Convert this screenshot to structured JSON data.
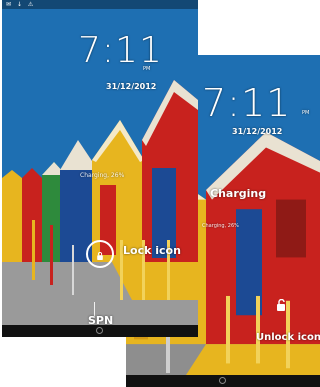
{
  "front_screen": {
    "clock_time": "7:11",
    "am_pm": "PM",
    "date": "31/12/2012",
    "charging_status": "Charging, 26%",
    "lock_label": "Lock icon",
    "carrier_label": "SPN",
    "status_icons": "✉ ↓ ⚠"
  },
  "back_screen": {
    "clock_time": "7:11",
    "am_pm": "PM",
    "date": "31/12/2012",
    "charging_label": "Charging",
    "charging_status": "Charging, 26%",
    "unlock_label": "Unlock icon"
  },
  "colors": {
    "sky": "#1e6fb2",
    "house_red": "#c8221e",
    "house_yellow": "#e7b51f",
    "house_blue": "#1c4a94",
    "house_green": "#2e8a3c",
    "sidewalk": "#9a9a9a"
  }
}
